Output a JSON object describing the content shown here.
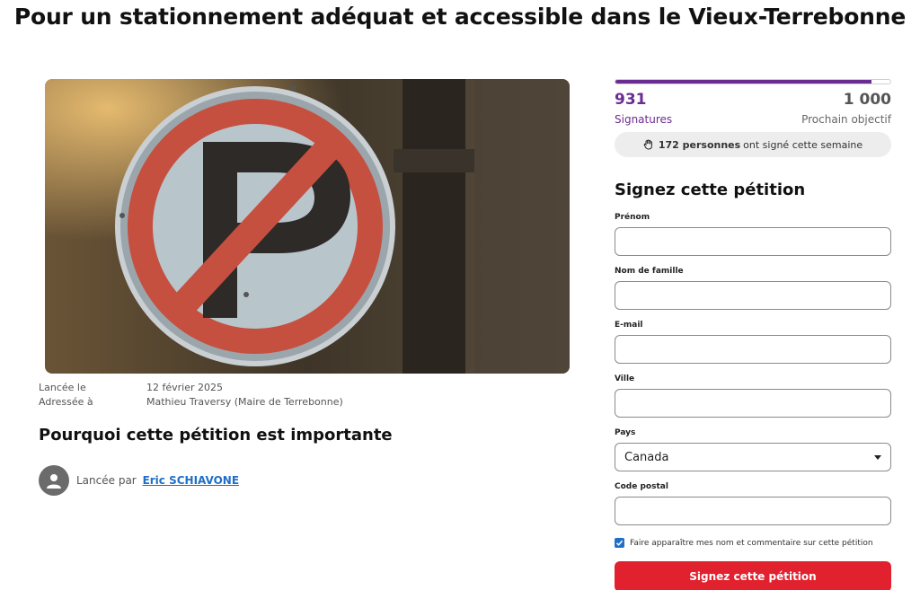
{
  "page": {
    "title": "Pour un stationnement adéquat et accessible dans le Vieux-Terrebonne"
  },
  "details": {
    "launched_label": "Lancée le",
    "launched_value": "12 février 2025",
    "addressed_label": "Adressée à",
    "addressed_value": "Mathieu Traversy (Maire de Terrebonne)"
  },
  "why_heading": "Pourquoi cette pétition est importante",
  "author": {
    "prefix": "Lancée par",
    "name": "Eric SCHIAVONE"
  },
  "progress": {
    "signatures_count": "931",
    "goal_count": "1 000",
    "fraction": 0.931,
    "signatures_label": "Signatures",
    "goal_label": "Prochain objectif",
    "weekly_bold": "172 personnes",
    "weekly_text": "ont signé cette semaine"
  },
  "form": {
    "title": "Signez cette pétition",
    "first_name_label": "Prénom",
    "last_name_label": "Nom de famille",
    "email_label": "E-mail",
    "city_label": "Ville",
    "country_label": "Pays",
    "country_value": "Canada",
    "postal_label": "Code postal",
    "consent_text": "Faire apparaître mes nom et commentaire sur cette pétition",
    "submit_label": "Signez cette pétition"
  },
  "colors": {
    "brand_purple": "#6b2c91",
    "submit_red": "#e2212e",
    "link_blue": "#1f6fc8"
  }
}
